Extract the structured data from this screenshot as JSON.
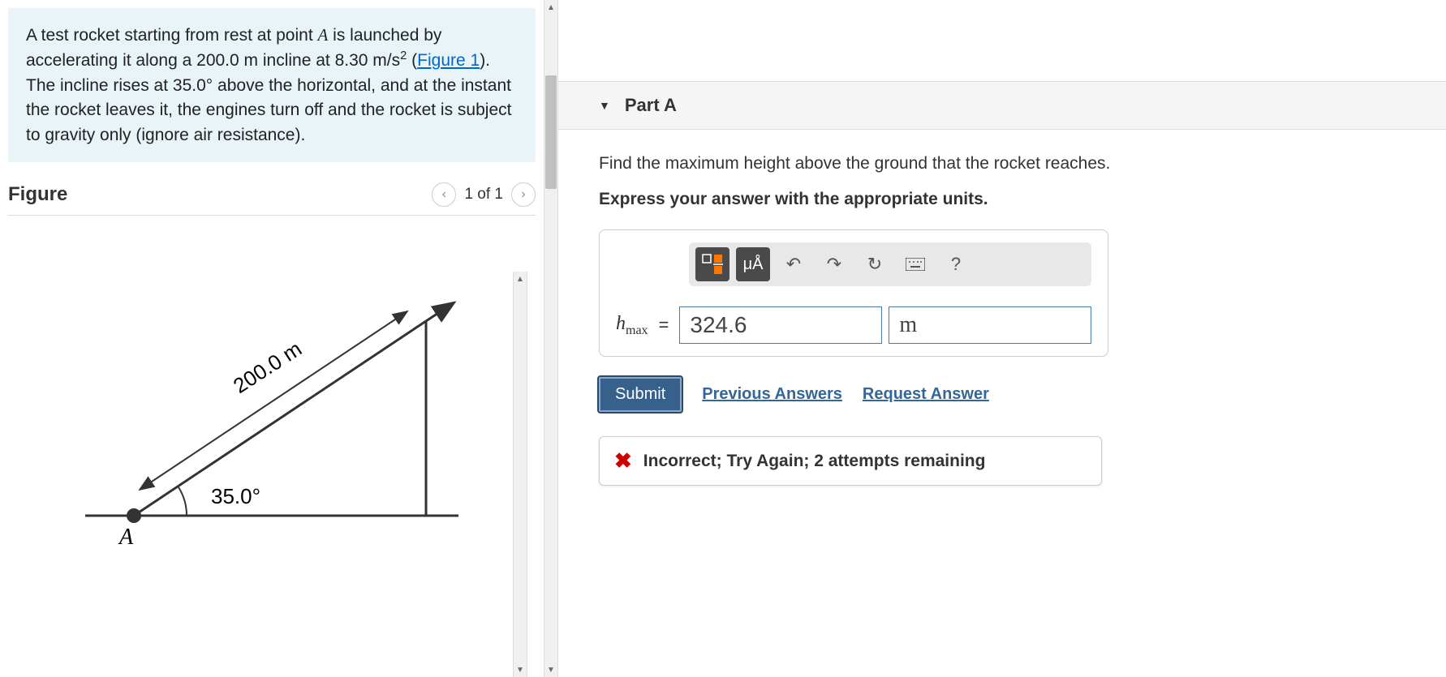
{
  "problem": {
    "text": "A test rocket starting from rest at point A is launched by accelerating it along a 200.0 m incline at 8.30 m/s² (Figure 1). The incline rises at 35.0° above the horizontal, and at the instant the rocket leaves it, the engines turn off and the rocket is subject to gravity only (ignore air resistance).",
    "point_label": "A",
    "incline_length": "200.0 m",
    "acceleration": "8.30 m/s²",
    "figure_link_text": "Figure 1",
    "angle": "35.0°"
  },
  "figure": {
    "title": "Figure",
    "counter": "1 of 1",
    "diagram": {
      "incline_label": "200.0 m",
      "angle_label": "35.0°",
      "point_label": "A"
    }
  },
  "part": {
    "label": "Part A",
    "question": "Find the maximum height above the ground that the rocket reaches.",
    "instruction": "Express your answer with the appropriate units.",
    "variable": "h",
    "variable_sub": "max",
    "answer_value": "324.6",
    "answer_unit": "m",
    "toolbar": {
      "units_label": "μÅ",
      "help_label": "?"
    },
    "buttons": {
      "submit": "Submit",
      "previous": "Previous Answers",
      "request": "Request Answer"
    },
    "feedback": "Incorrect; Try Again; 2 attempts remaining"
  }
}
